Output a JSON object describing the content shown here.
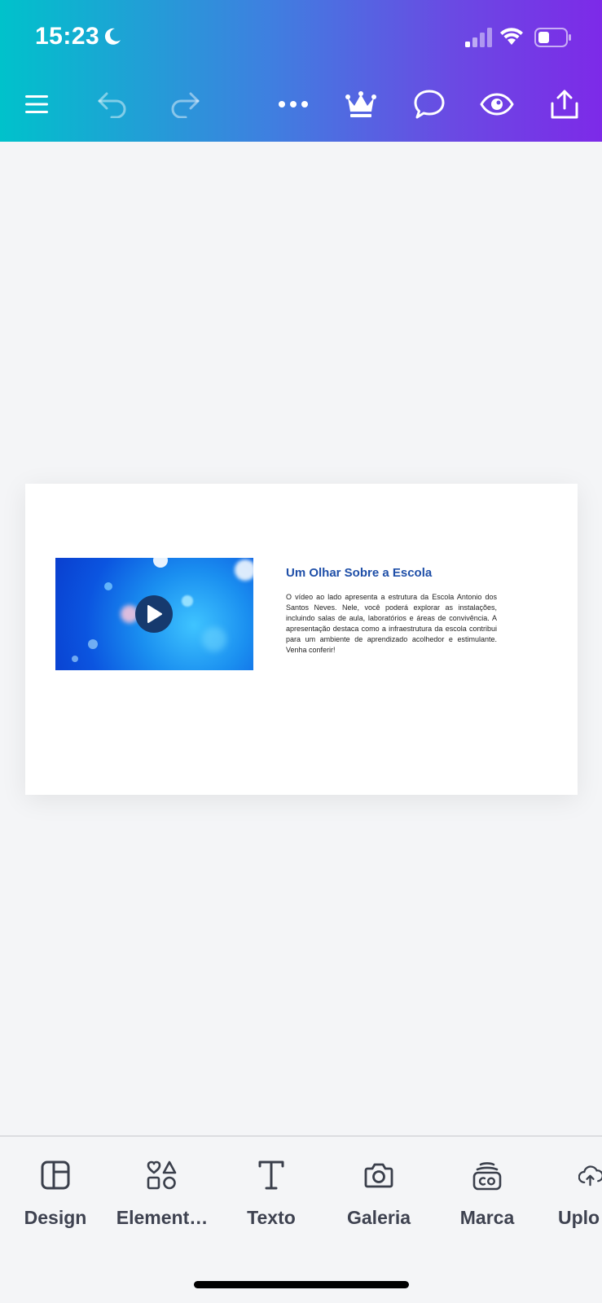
{
  "status_bar": {
    "time": "15:23"
  },
  "toolbar": {
    "menu_icon": "hamburger-icon",
    "undo_icon": "undo-icon",
    "redo_icon": "redo-icon",
    "more_icon": "more-icon",
    "crown_icon": "crown-icon",
    "comment_icon": "comment-icon",
    "preview_icon": "eye-icon",
    "share_icon": "share-icon"
  },
  "slide": {
    "title": "Um Olhar Sobre a Escola",
    "body": "O vídeo ao lado apresenta a estrutura da Escola Antonio dos Santos Neves. Nele, você poderá explorar as instalações, incluindo salas de aula, laboratórios e áreas de convivência. A apresentação destaca como a infraestrutura da escola contribui para um ambiente de aprendizado acolhedor e estimulante. Venha conferir!",
    "title_color": "#1f4fa8"
  },
  "bottom_nav": {
    "items": [
      {
        "label": "Design",
        "icon": "design-icon"
      },
      {
        "label": "Element…",
        "icon": "elements-icon"
      },
      {
        "label": "Texto",
        "icon": "text-icon"
      },
      {
        "label": "Galeria",
        "icon": "camera-icon"
      },
      {
        "label": "Marca",
        "icon": "brand-icon"
      },
      {
        "label": "Uplo",
        "icon": "upload-icon"
      }
    ]
  },
  "colors": {
    "gradient_start": "#00c2cb",
    "gradient_end": "#7d2ae8"
  }
}
